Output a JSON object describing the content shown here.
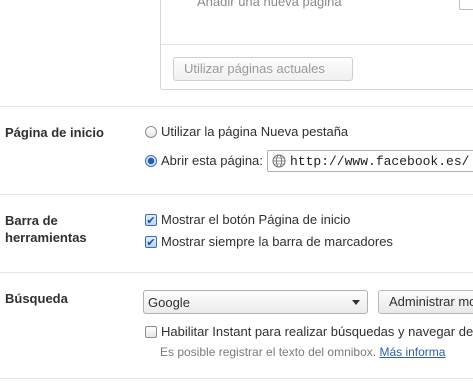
{
  "startup": {
    "add_page_text": "Añadir una nueva página",
    "use_current_button": "Utilizar páginas actuales"
  },
  "home_page": {
    "title": "Página de inicio",
    "option_new_tab": "Utilizar la página Nueva pestaña",
    "option_open_page": "Abrir esta página:",
    "selected_option": "open_page",
    "url_value": "http://www.facebook.es/"
  },
  "toolbar": {
    "title_line1": "Barra de",
    "title_line2": "herramientas",
    "show_home_button": "Mostrar el botón Página de inicio",
    "show_home_button_checked": true,
    "show_bookmarks_bar": "Mostrar siempre la barra de marcadores",
    "show_bookmarks_bar_checked": true
  },
  "search": {
    "title": "Búsqueda",
    "engine_selected": "Google",
    "manage_button": "Administrar mo",
    "instant_label": "Habilitar Instant para realizar búsquedas y navegar de",
    "instant_checked": false,
    "hint_text": "Es posible registrar el texto del omnibox.",
    "hint_link": "Más informa"
  },
  "icons": {
    "checkmark": "✔",
    "globe": "globe-icon",
    "dropdown": "chevron-down-icon"
  },
  "colors": {
    "accent": "#2a5ea8",
    "link": "#2a5db0",
    "hint": "#7a7a7a"
  }
}
